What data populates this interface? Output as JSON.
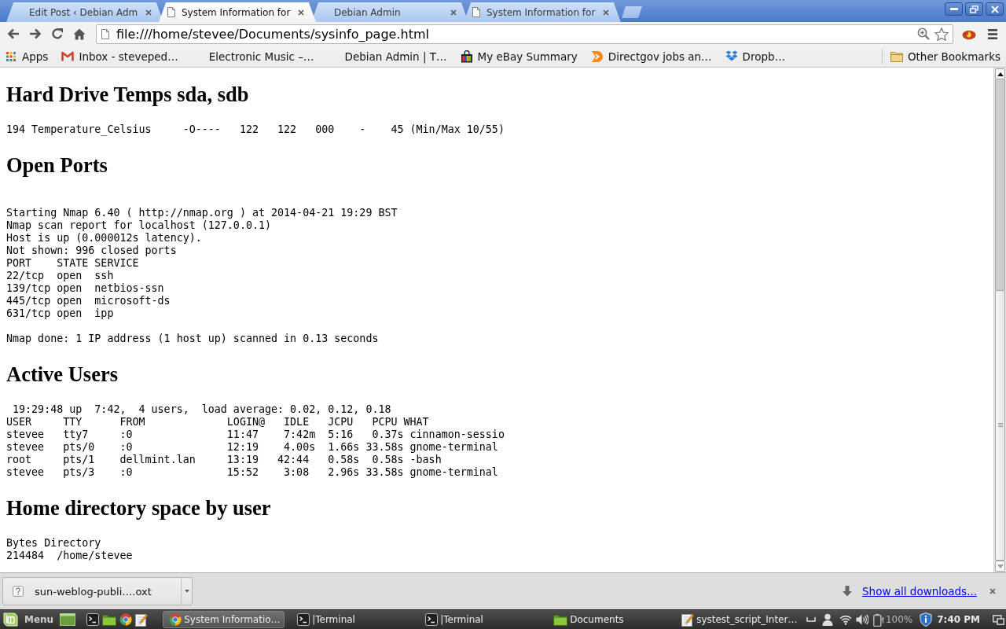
{
  "tabs": [
    {
      "title": "Edit Post ‹ Debian Adm",
      "favicon": false,
      "selected": false
    },
    {
      "title": "System Information for",
      "favicon": true,
      "selected": true
    },
    {
      "title": "Debian Admin",
      "favicon": false,
      "selected": false
    },
    {
      "title": "System Information for",
      "favicon": true,
      "selected": false
    }
  ],
  "address_bar": {
    "value": "file:///home/stevee/Documents/sysinfo_page.html"
  },
  "bookmarks": [
    {
      "label": "Apps",
      "kind": "grid"
    },
    {
      "label": "Inbox - steveped…",
      "kind": "mail"
    },
    {
      "label": "Electronic Music –…",
      "kind": "blank"
    },
    {
      "label": "Debian Admin | T…",
      "kind": "blank"
    },
    {
      "label": "My eBay Summary",
      "kind": "bag"
    },
    {
      "label": "Directgov jobs an…",
      "kind": "arrow"
    },
    {
      "label": "Dropb…",
      "kind": "box"
    }
  ],
  "other_bookmarks": {
    "label": "Other Bookmarks"
  },
  "page": {
    "sections": [
      {
        "heading": "Hard Drive Temps sda, sdb",
        "output": "194 Temperature_Celsius     -O----   122   122   000    -    45 (Min/Max 10/55)"
      },
      {
        "heading": "Open Ports",
        "output": "\nStarting Nmap 6.40 ( http://nmap.org ) at 2014-04-21 19:29 BST\nNmap scan report for localhost (127.0.0.1)\nHost is up (0.000012s latency).\nNot shown: 996 closed ports\nPORT    STATE SERVICE\n22/tcp  open  ssh\n139/tcp open  netbios-ssn\n445/tcp open  microsoft-ds\n631/tcp open  ipp\n\nNmap done: 1 IP address (1 host up) scanned in 0.13 seconds"
      },
      {
        "heading": "Active Users",
        "output": " 19:29:48 up  7:42,  4 users,  load average: 0.02, 0.12, 0.18\nUSER     TTY      FROM             LOGIN@   IDLE   JCPU   PCPU WHAT\nstevee   tty7     :0               11:47    7:42m  5:16   0.37s cinnamon-sessio\nstevee   pts/0    :0               12:19    4.00s  1.66s 33.58s gnome-terminal\nroot     pts/1    dellmint.lan     13:19   42:44   0.58s  0.58s -bash\nstevee   pts/3    :0               15:52    3:08   2.96s 33.58s gnome-terminal"
      },
      {
        "heading": "Home directory space by user",
        "output": "Bytes Directory\n214484  /home/stevee"
      }
    ]
  },
  "downloads_bar": {
    "item": {
      "filename": "sun-weblog-publi….oxt"
    },
    "show_all": "Show all downloads..."
  },
  "taskbar": {
    "menu_label": "Menu",
    "windows": [
      {
        "title": "System Informatio…",
        "kind": "browser",
        "selected": true
      },
      {
        "title": "|Terminal",
        "kind": "terminal",
        "selected": false
      },
      {
        "title": "|Terminal",
        "kind": "terminal",
        "selected": false
      },
      {
        "title": "Documents",
        "kind": "folder",
        "selected": false
      },
      {
        "title": "systest_script_Inter…",
        "kind": "editor",
        "selected": false
      }
    ],
    "battery": "100%",
    "clock": "7:40 PM"
  }
}
